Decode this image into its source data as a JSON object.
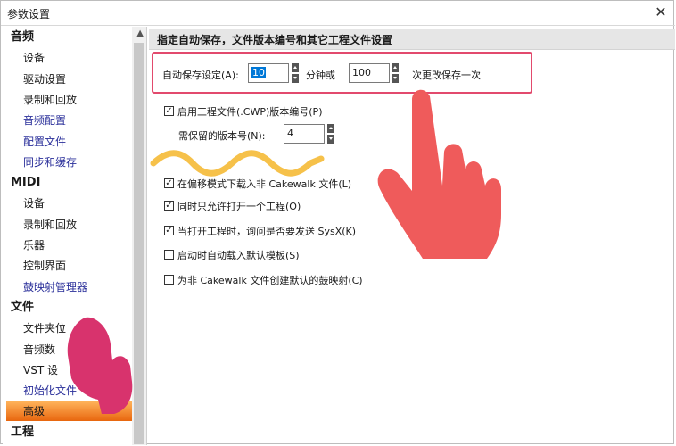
{
  "window": {
    "title": "参数设置",
    "close_glyph": "✕"
  },
  "sidebar": {
    "scroll_up_glyph": "▲",
    "items": [
      {
        "label": "音频",
        "kind": "cat"
      },
      {
        "label": "设备",
        "kind": "sub"
      },
      {
        "label": "驱动设置",
        "kind": "sub"
      },
      {
        "label": "录制和回放",
        "kind": "sub"
      },
      {
        "label": "音频配置",
        "kind": "link"
      },
      {
        "label": "配置文件",
        "kind": "link"
      },
      {
        "label": "同步和缓存",
        "kind": "link"
      },
      {
        "label": "MIDI",
        "kind": "cat"
      },
      {
        "label": "设备",
        "kind": "sub"
      },
      {
        "label": "录制和回放",
        "kind": "sub"
      },
      {
        "label": "乐器",
        "kind": "sub"
      },
      {
        "label": "控制界面",
        "kind": "sub"
      },
      {
        "label": "鼓映射管理器",
        "kind": "link"
      },
      {
        "label": "文件",
        "kind": "cat"
      },
      {
        "label": "文件夹位",
        "kind": "sub"
      },
      {
        "label": "音频数",
        "kind": "sub"
      },
      {
        "label": "VST 设",
        "kind": "sub"
      },
      {
        "label": "初始化文件",
        "kind": "link"
      },
      {
        "label": "高级",
        "kind": "sel"
      },
      {
        "label": "工程",
        "kind": "cat"
      }
    ]
  },
  "panel": {
    "header": "指定自动保存，文件版本编号和其它工程文件设置",
    "autosave": {
      "label": "自动保存设定(A):",
      "minutes_value": "10",
      "minutes_unit": "分钟或",
      "changes_value": "100",
      "changes_unit": "次更改保存一次"
    },
    "versioning": {
      "label": "启用工程文件(.CWP)版本编号(P)",
      "checked": true,
      "keep_label": "需保留的版本号(N):",
      "keep_value": "4"
    },
    "options": [
      {
        "label": "在偏移模式下载入非 Cakewalk 文件(L)",
        "checked": true
      },
      {
        "label": "同时只允许打开一个工程(O)",
        "checked": true
      },
      {
        "label": "当打开工程时，询问是否要发送 SysX(K)",
        "checked": true
      },
      {
        "label": "启动时自动载入默认模板(S)",
        "checked": false
      },
      {
        "label": "为非 Cakewalk 文件创建默认的鼓映射(C)",
        "checked": false
      }
    ]
  },
  "check_glyph": "✓",
  "colors": {
    "highlight": "#e24a6d",
    "selection": "#e8660e",
    "link": "#2a2f9a",
    "squiggle": "#f6c14a",
    "hand_right": "#ef5b5b",
    "hand_left": "#d8336d"
  },
  "annotations": {
    "right_hand": "pointing-hand-icon",
    "left_hand": "pointing-hand-icon",
    "wave": "squiggle"
  }
}
